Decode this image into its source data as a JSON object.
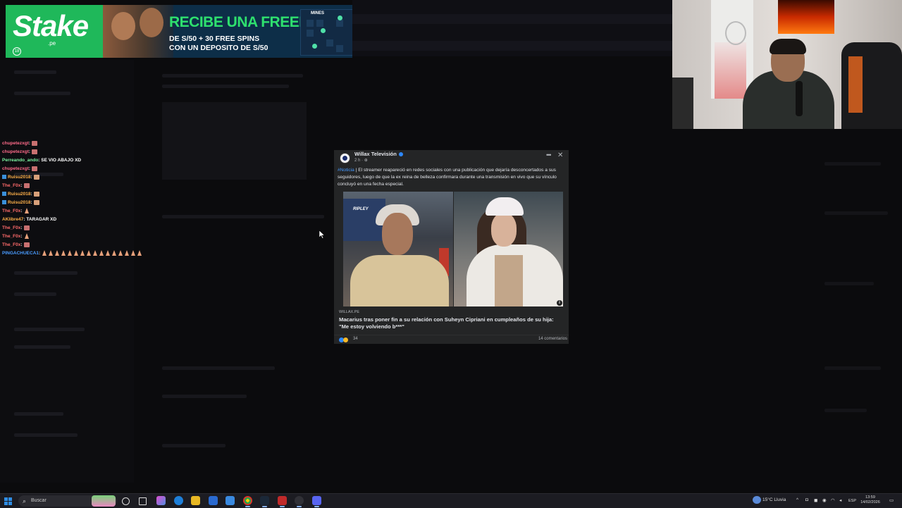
{
  "ad": {
    "logo": "Stake",
    "logo_sub": ".pe",
    "headline": "RECIBE UNA FREEBET",
    "line1": "DE S/50 + 30 FREE SPINS",
    "line2": "CON UN DEPOSITO DE S/50",
    "age_badge": "18",
    "game_title": "MINES",
    "colors": {
      "brand_green": "#1fb85a",
      "headline_green": "#2ee06e",
      "bg": "#0d2e48"
    }
  },
  "chat": {
    "messages": [
      {
        "user": "chupetezxgt",
        "color": "#ff6b8a",
        "text": ":",
        "emote": "square"
      },
      {
        "user": "chupetezxgt",
        "color": "#ff6b8a",
        "text": ":",
        "emote": "square"
      },
      {
        "user": "Perreando_ando",
        "color": "#7cf2a0",
        "text": ": SE VIO ABAJO XD",
        "emote": ""
      },
      {
        "user": "chupetezxgt",
        "color": "#ff6b8a",
        "text": ":",
        "emote": "square"
      },
      {
        "user": "Ruisu2018",
        "color": "#ffb14a",
        "text": ":",
        "emote": "hand",
        "badge": true
      },
      {
        "user": "The_F0x",
        "color": "#ff6b6b",
        "text": ":",
        "emote": "square"
      },
      {
        "user": "Ruisu2018",
        "color": "#ffb14a",
        "text": ":",
        "emote": "hand",
        "badge": true
      },
      {
        "user": "Ruisu2018",
        "color": "#ffb14a",
        "text": ":",
        "emote": "hand",
        "badge": true
      },
      {
        "user": "The_F0x",
        "color": "#ff6b6b",
        "text": ":",
        "emote": "cone"
      },
      {
        "user": "AKlibre47",
        "color": "#ffb14a",
        "text": ": TARAGAR XD",
        "emote": ""
      },
      {
        "user": "The_F0x",
        "color": "#ff6b6b",
        "text": ":",
        "emote": "square"
      },
      {
        "user": "The_F0x",
        "color": "#ff6b6b",
        "text": ":",
        "emote": "cone"
      },
      {
        "user": "The_F0x",
        "color": "#ff6b6b",
        "text": ":",
        "emote": "square"
      },
      {
        "user": "PINGACHUECA1",
        "color": "#4a9cff",
        "text": ":",
        "emote": "cones"
      }
    ]
  },
  "post": {
    "page_name": "Willax Televisión",
    "time": "2 h · ",
    "menu_icon": "more-icon",
    "close_icon": "close-icon",
    "hashtag": "#Noticia",
    "body": " | El streamer reapareció en redes sociales con una publicación que dejaría desconcertados a sus seguidores, luego de que la ex reina de belleza confirmara durante una transmisión en vivo que su vínculo concluyó en una fecha especial.",
    "store_sign": "RIPLEY",
    "info_icon": "i",
    "link_domain": "WILLAX.PE",
    "link_title": "Macarius tras poner fin a su relación con Suheyn Cipriani en cumpleaños de su hija: \"Me estoy volviendo b***\"",
    "reactions_count": "34",
    "comments": "14 comentarios",
    "colors": {
      "card_bg": "#242526",
      "hashtag": "#4599ff",
      "verified": "#2d88ff"
    }
  },
  "taskbar": {
    "search_label": "Buscar",
    "weather": "15°C Lluvia",
    "lang": "ESP",
    "time": "13:59",
    "date": "14/02/2026"
  }
}
